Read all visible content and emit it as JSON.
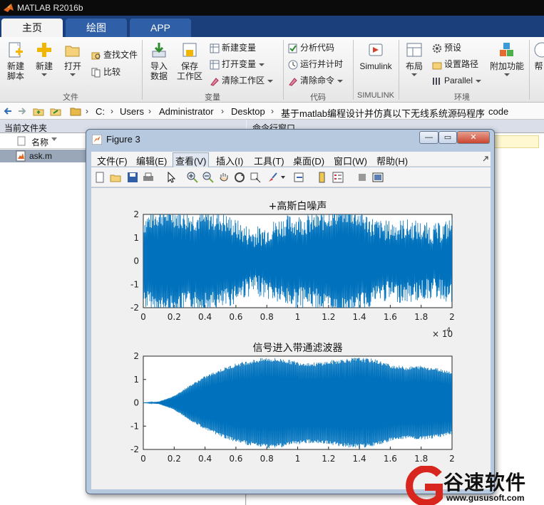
{
  "app": {
    "title": "MATLAB R2016b",
    "tabs": [
      "主页",
      "绘图",
      "APP"
    ]
  },
  "ribbon": {
    "file": {
      "new_script": "新建\n脚本",
      "new": "新建",
      "open": "打开",
      "find_files": "查找文件",
      "compare": "比较",
      "label": "文件"
    },
    "variable": {
      "import_data": "导入\n数据",
      "save_workspace": "保存\n工作区",
      "new_variable": "新建变量",
      "open_variable": "打开变量",
      "clear_workspace": "清除工作区",
      "label": "变量"
    },
    "code": {
      "analyze_code": "分析代码",
      "run_and_time": "运行并计时",
      "clear_commands": "清除命令",
      "label": "代码"
    },
    "simulink": {
      "simulink": "Simulink",
      "label": "SIMULINK"
    },
    "environment": {
      "layout": "布局",
      "preferences": "预设",
      "set_path": "设置路径",
      "parallel": "Parallel",
      "addons": "附加功能",
      "label": "环境"
    },
    "help_partial": "帮"
  },
  "path": [
    "C:",
    "Users",
    "Administrator",
    "Desktop",
    "基于matlab编程设计并仿真以下无线系统源码程序",
    "code"
  ],
  "current_folder": {
    "title": "当前文件夹",
    "column": "名称",
    "files": [
      "ask.m"
    ]
  },
  "command_window": {
    "title": "命令行窗口"
  },
  "figure": {
    "title": "Figure 3",
    "menus": [
      "文件(F)",
      "编辑(E)",
      "查看(V)",
      "插入(I)",
      "工具(T)",
      "桌面(D)",
      "窗口(W)",
      "帮助(H)"
    ],
    "active_menu": 2,
    "window_buttons": {
      "min": "—",
      "max": "▭",
      "close": "✕"
    }
  },
  "chart_data": [
    {
      "type": "line",
      "title": "+高斯白噪声",
      "xlim": [
        0,
        2
      ],
      "ylim": [
        -2,
        2
      ],
      "x_ticks": [
        "0",
        "0.2",
        "0.4",
        "0.6",
        "0.8",
        "1",
        "1.2",
        "1.4",
        "1.6",
        "1.8",
        "2"
      ],
      "y_ticks": [
        "2",
        "1",
        "0",
        "-1",
        "-2"
      ],
      "x_exponent": "× 10",
      "x_exponent_power": "-4",
      "series_color": "#0072bd",
      "description_of_signal": "dense oscillation filling nearly [-2, 2] with noise"
    },
    {
      "type": "line",
      "title": "信号进入带通滤波器",
      "xlim": [
        0,
        2
      ],
      "ylim": [
        -2,
        2
      ],
      "x_ticks": [
        "0",
        "0.2",
        "0.4",
        "0.6",
        "0.8",
        "1",
        "1.2",
        "1.4",
        "1.6",
        "1.8",
        "2"
      ],
      "y_ticks": [
        "2",
        "1",
        "0",
        "-1",
        "-2"
      ],
      "envelope_x": [
        0,
        0.1,
        0.2,
        0.3,
        0.4,
        0.5,
        0.6,
        0.7,
        0.8,
        0.9,
        1.0,
        1.1,
        1.2,
        1.3,
        1.4,
        1.5,
        1.6,
        1.7,
        1.8,
        1.9,
        2.0
      ],
      "envelope_y": [
        0.0,
        0.05,
        0.3,
        0.75,
        1.15,
        1.45,
        1.7,
        1.85,
        1.95,
        1.9,
        1.78,
        1.72,
        1.8,
        1.9,
        1.95,
        1.88,
        1.65,
        1.55,
        1.6,
        1.5,
        1.35
      ],
      "series_color": "#0072bd"
    }
  ],
  "watermark": {
    "name": "谷速软件",
    "url": "www.gususoft.com"
  }
}
